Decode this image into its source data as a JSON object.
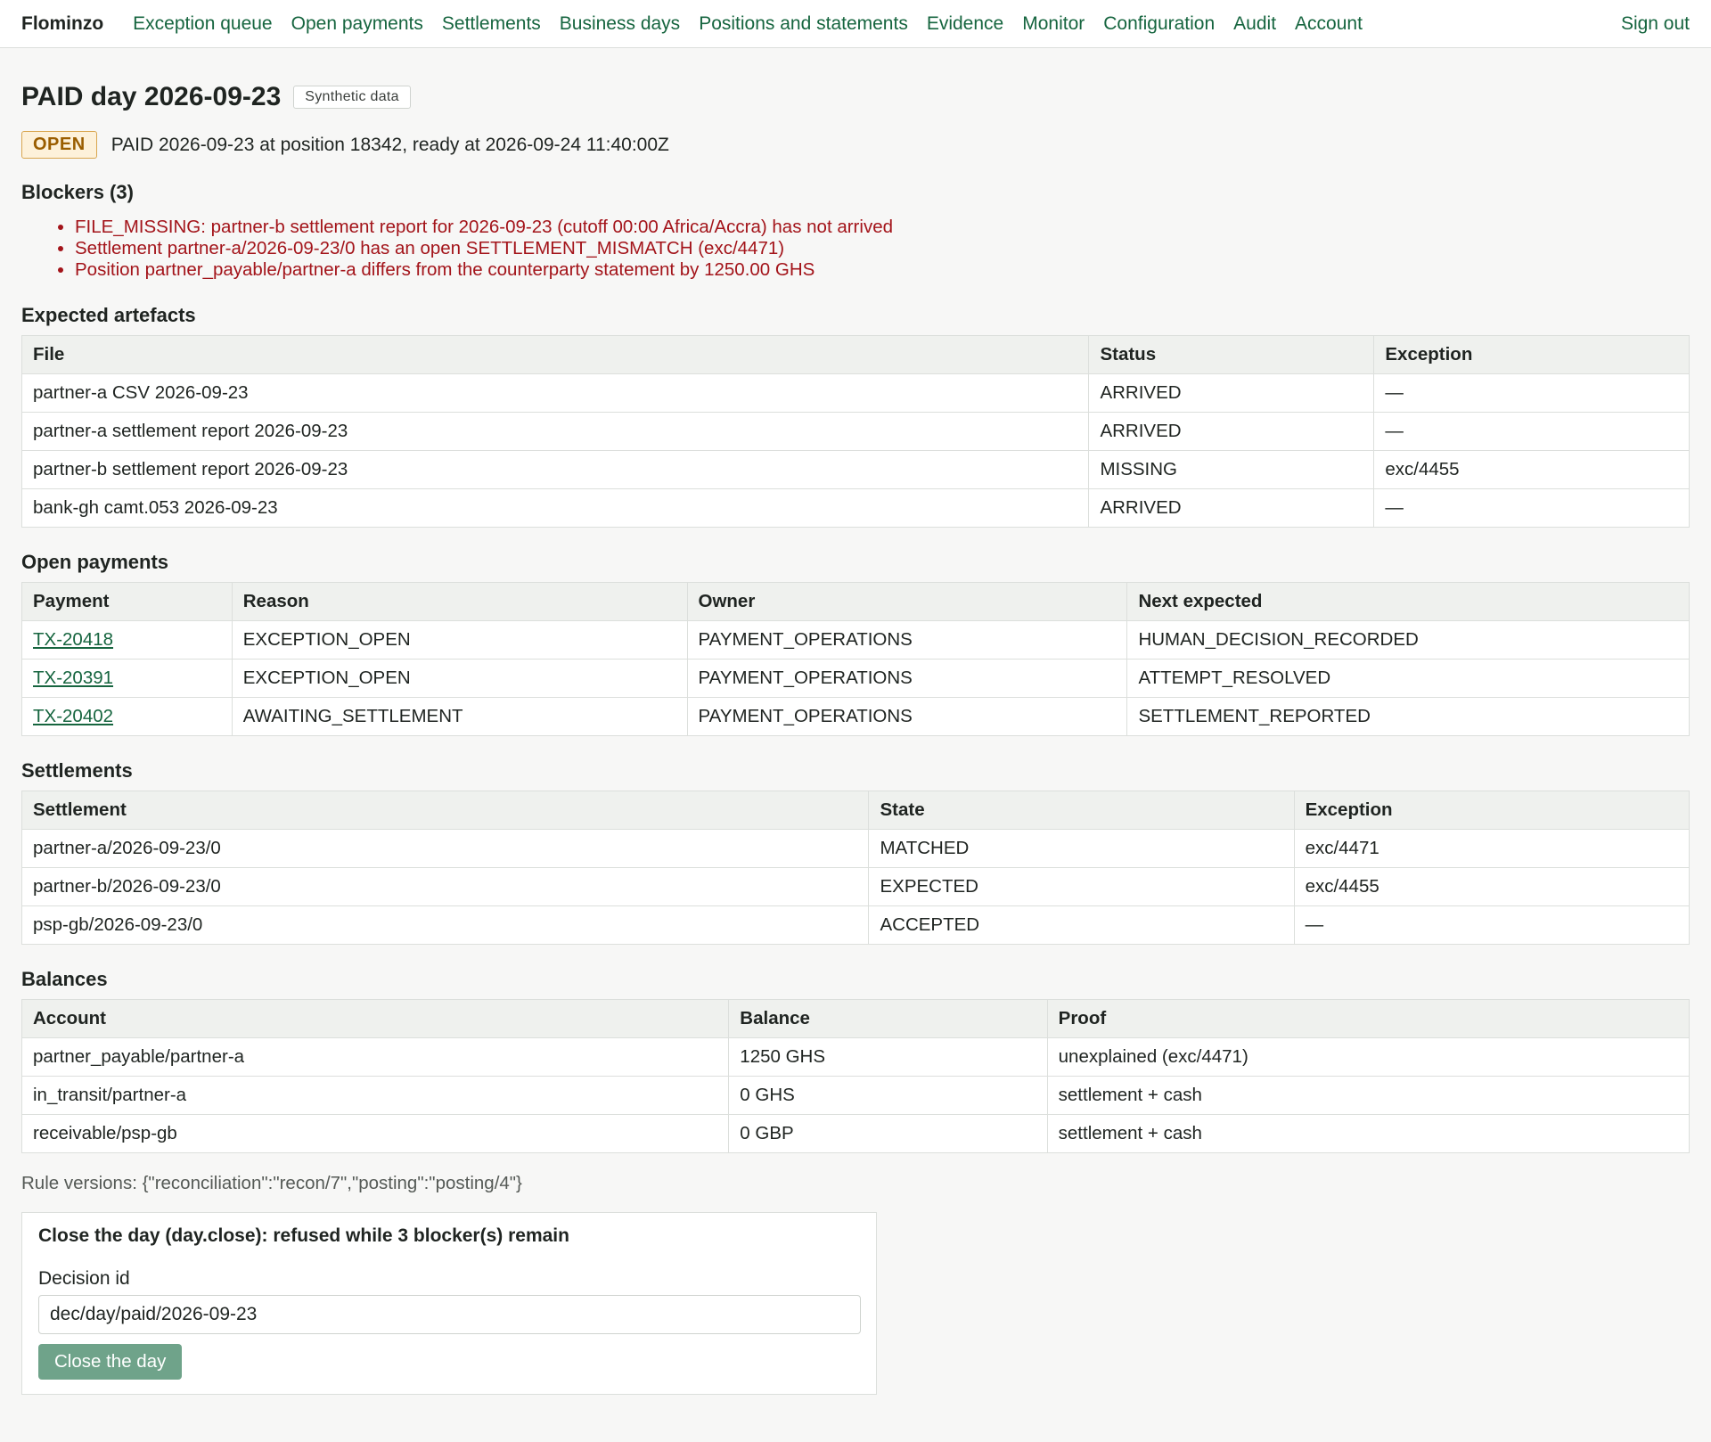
{
  "nav": {
    "brand": "Flominzo",
    "links": [
      "Exception queue",
      "Open payments",
      "Settlements",
      "Business days",
      "Positions and statements",
      "Evidence",
      "Monitor",
      "Configuration",
      "Audit",
      "Account"
    ],
    "sign_out": "Sign out"
  },
  "page": {
    "title": "PAID day 2026-09-23",
    "synthetic_tag": "Synthetic data",
    "status_badge": "OPEN",
    "status_text": "PAID 2026-09-23 at position 18342, ready at 2026-09-24 11:40:00Z"
  },
  "blockers": {
    "heading": "Blockers (3)",
    "items": [
      "FILE_MISSING: partner-b settlement report for 2026-09-23 (cutoff 00:00 Africa/Accra) has not arrived",
      "Settlement partner-a/2026-09-23/0 has an open SETTLEMENT_MISMATCH (exc/4471)",
      "Position partner_payable/partner-a differs from the counterparty statement by 1250.00 GHS"
    ]
  },
  "artefacts": {
    "heading": "Expected artefacts",
    "columns": [
      "File",
      "Status",
      "Exception"
    ],
    "rows": [
      [
        "partner-a CSV 2026-09-23",
        "ARRIVED",
        "—"
      ],
      [
        "partner-a settlement report 2026-09-23",
        "ARRIVED",
        "—"
      ],
      [
        "partner-b settlement report 2026-09-23",
        "MISSING",
        "exc/4455"
      ],
      [
        "bank-gh camt.053 2026-09-23",
        "ARRIVED",
        "—"
      ]
    ]
  },
  "open_payments": {
    "heading": "Open payments",
    "columns": [
      "Payment",
      "Reason",
      "Owner",
      "Next expected"
    ],
    "rows": [
      [
        "TX-20418",
        "EXCEPTION_OPEN",
        "PAYMENT_OPERATIONS",
        "HUMAN_DECISION_RECORDED"
      ],
      [
        "TX-20391",
        "EXCEPTION_OPEN",
        "PAYMENT_OPERATIONS",
        "ATTEMPT_RESOLVED"
      ],
      [
        "TX-20402",
        "AWAITING_SETTLEMENT",
        "PAYMENT_OPERATIONS",
        "SETTLEMENT_REPORTED"
      ]
    ]
  },
  "settlements": {
    "heading": "Settlements",
    "columns": [
      "Settlement",
      "State",
      "Exception"
    ],
    "rows": [
      [
        "partner-a/2026-09-23/0",
        "MATCHED",
        "exc/4471"
      ],
      [
        "partner-b/2026-09-23/0",
        "EXPECTED",
        "exc/4455"
      ],
      [
        "psp-gb/2026-09-23/0",
        "ACCEPTED",
        "—"
      ]
    ]
  },
  "balances": {
    "heading": "Balances",
    "columns": [
      "Account",
      "Balance",
      "Proof"
    ],
    "rows": [
      [
        "partner_payable/partner-a",
        "1250 GHS",
        "unexplained (exc/4471)"
      ],
      [
        "in_transit/partner-a",
        "0 GHS",
        "settlement + cash"
      ],
      [
        "receivable/psp-gb",
        "0 GBP",
        "settlement + cash"
      ]
    ]
  },
  "rule_versions": "Rule versions: {\"reconciliation\":\"recon/7\",\"posting\":\"posting/4\"}",
  "close_day": {
    "title": "Close the day (day.close): refused while 3 blocker(s) remain",
    "decision_label": "Decision id",
    "decision_value": "dec/day/paid/2026-09-23",
    "button_label": "Close the day"
  }
}
